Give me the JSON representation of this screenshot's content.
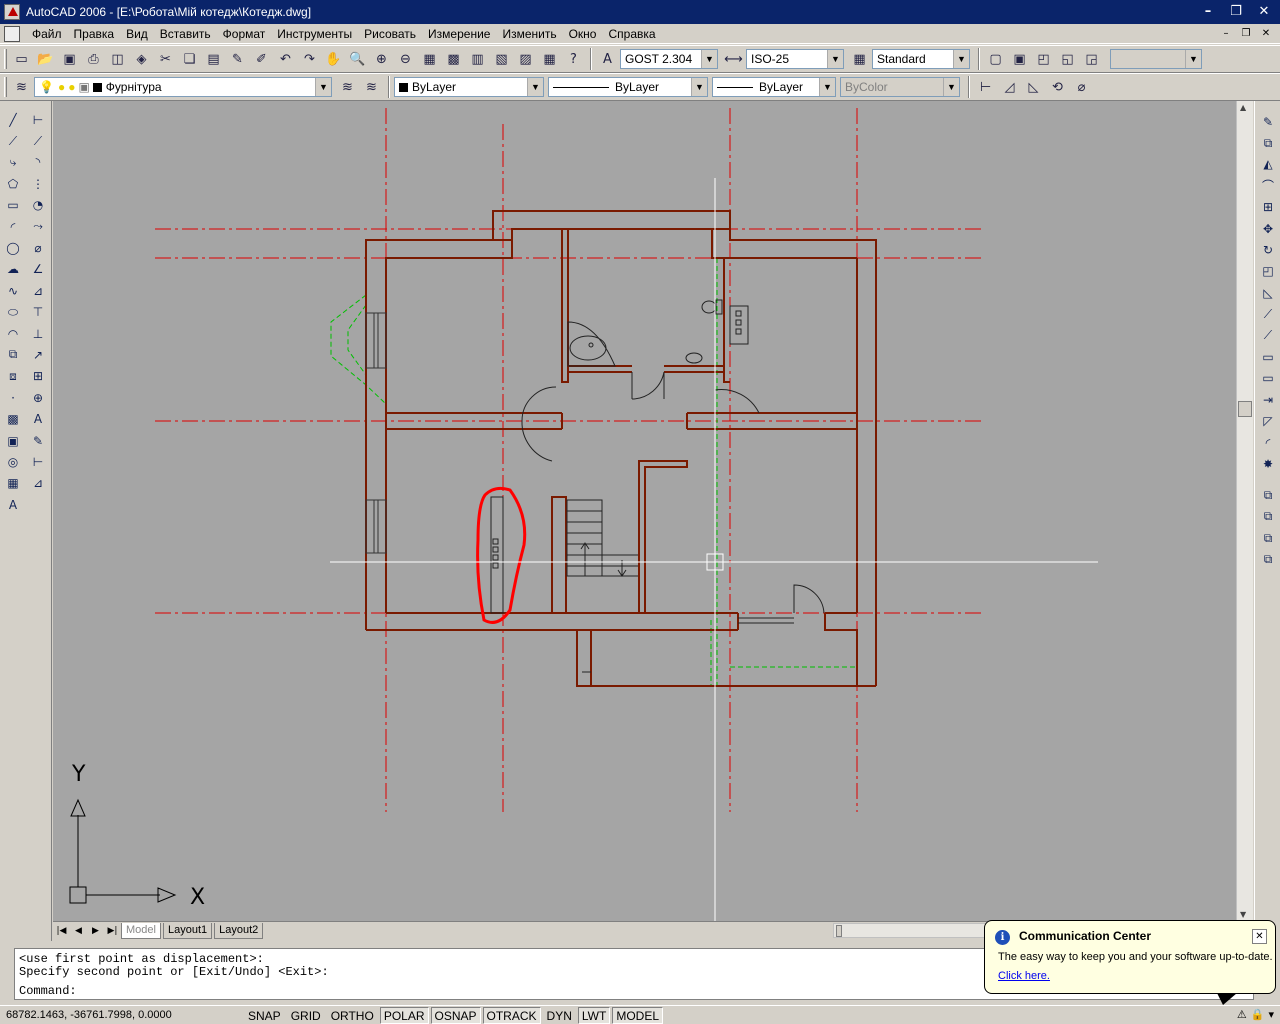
{
  "window": {
    "title": "AutoCAD 2006 - [E:\\Робота\\Мій котедж\\Котедж.dwg]"
  },
  "menu": [
    "Файл",
    "Правка",
    "Вид",
    "Вставить",
    "Формат",
    "Инструменты",
    "Рисовать",
    "Измерение",
    "Изменить",
    "Окно",
    "Справка"
  ],
  "styles": {
    "text_style": "GOST 2.304",
    "dim_style": "ISO-25",
    "table_style": "Standard"
  },
  "layers": {
    "current_layer": "Фурнітура"
  },
  "properties": {
    "color": "ByLayer",
    "linetype": "ByLayer",
    "lineweight": "ByLayer",
    "plot_style": "ByColor"
  },
  "ucs": {
    "x_label": "X",
    "y_label": "Y"
  },
  "layout_tabs": [
    "Model",
    "Layout1",
    "Layout2"
  ],
  "command": {
    "history": [
      "<use first point as displacement>:",
      "Specify second point or [Exit/Undo] <Exit>:"
    ],
    "prompt": "Command:"
  },
  "status": {
    "coords": "68782.1463, -36761.7998, 0.0000",
    "toggles": [
      {
        "label": "SNAP",
        "on": false
      },
      {
        "label": "GRID",
        "on": false
      },
      {
        "label": "ORTHO",
        "on": false
      },
      {
        "label": "POLAR",
        "on": true
      },
      {
        "label": "OSNAP",
        "on": true
      },
      {
        "label": "OTRACK",
        "on": true
      },
      {
        "label": "DYN",
        "on": false
      },
      {
        "label": "LWT",
        "on": true
      },
      {
        "label": "MODEL",
        "on": true
      }
    ]
  },
  "notification": {
    "title": "Communication Center",
    "text": "The easy way to keep you and your software up-to-date.",
    "link": "Click here."
  },
  "colors": {
    "canvas": "#a5a5a5",
    "wall": "#7a1a00",
    "axis": "#e00000",
    "highlight": "#ff0000",
    "guide": "#00c000"
  }
}
